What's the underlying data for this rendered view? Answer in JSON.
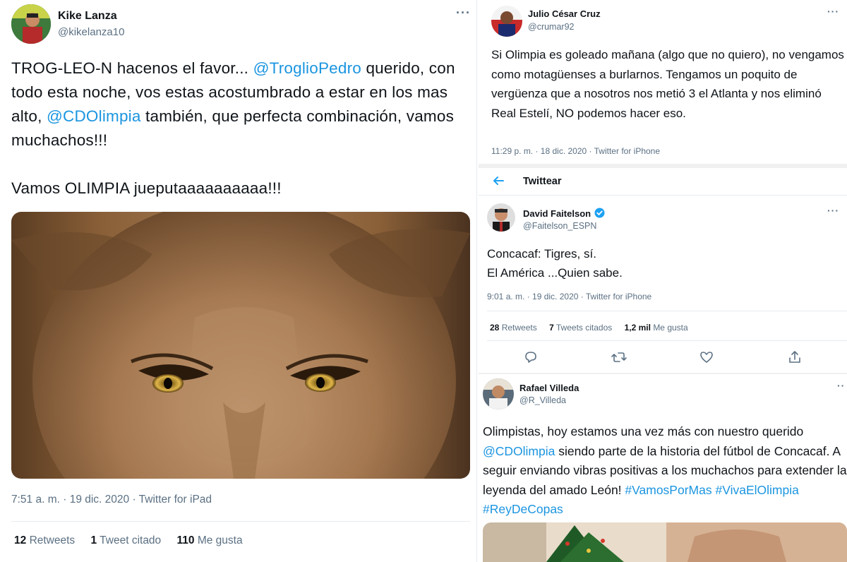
{
  "left_tweet": {
    "name": "Kike Lanza",
    "handle": "@kikelanza10",
    "text_line1_pre": "TROG-LEO-N hacenos el favor... ",
    "mention1": "@TroglioPedro",
    "text_line1_post": " querido, con todo esta noche, vos estas acostumbrado a estar en los mas alto, ",
    "mention2": "@CDOlimpia",
    "text_line2_post": " también, que perfecta combinación, vamos muchachos!!!",
    "text_para2": "Vamos OLIMPIA jueputaaaaaaaaaa!!!",
    "timestamp": "7:51 a. m. · 19 dic. 2020 · Twitter for iPad",
    "retweets_count": "12",
    "retweets_label": "Retweets",
    "quotes_count": "1",
    "quotes_label": "Tweet citado",
    "likes_count": "110",
    "likes_label": "Me gusta"
  },
  "tweet_julio": {
    "name": "Julio César Cruz",
    "handle": "@crumar92",
    "text": "Si Olimpia es goleado mañana (algo que no quiero), no vengamos como motagüenses a burlarnos. Tengamos un poquito de vergüenza que a nosotros nos metió 3 el Atlanta y nos eliminó Real Estelí, NO podemos hacer eso.",
    "timestamp": "11:29 p. m. · 18 dic. 2020 · Twitter for iPhone"
  },
  "thread_header": {
    "title": "Twittear"
  },
  "tweet_david": {
    "name": "David Faitelson",
    "handle": "@Faitelson_ESPN",
    "text_line1": "Concacaf: Tigres, sí.",
    "text_line2": "El América ...Quien sabe.",
    "timestamp": "9:01 a. m. · 19 dic. 2020 · Twitter for iPhone",
    "retweets_count": "28",
    "retweets_label": "Retweets",
    "quotes_count": "7",
    "quotes_label": "Tweets citados",
    "likes_count": "1,2 mil",
    "likes_label": "Me gusta"
  },
  "tweet_rafael": {
    "name": "Rafael Villeda",
    "handle": "@R_Villeda",
    "text_pre": "Olimpistas, hoy estamos una vez más con nuestro querido ",
    "mention": "@CDOlimpia",
    "text_post": " siendo parte de la historia del fútbol de Concacaf. A seguir enviando vibras positivas a los muchachos para extender la leyenda del amado León! ",
    "hashtag1": "#VamosPorMas",
    "hashtag2": "#VivaElOlimpia",
    "hashtag3": "#ReyDeCopas"
  },
  "icons": {
    "more": "more-icon",
    "back": "back-arrow-icon",
    "verified": "verified-badge-icon",
    "reply": "reply-icon",
    "retweet": "retweet-icon",
    "like": "like-icon",
    "share": "share-icon"
  },
  "colors": {
    "link": "#1b95e0",
    "muted": "#5b7083",
    "verified": "#1da1f2"
  }
}
